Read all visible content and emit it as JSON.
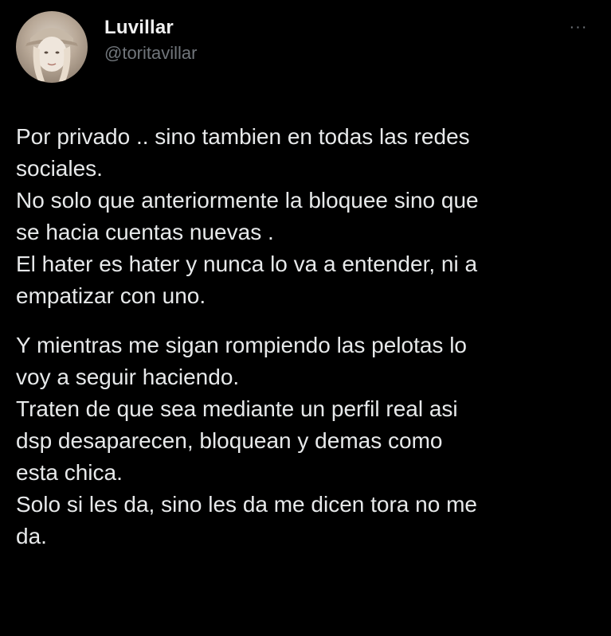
{
  "tweet": {
    "display_name": "Luvillar",
    "handle": "@toritavillar",
    "more_label": "···",
    "paragraphs": [
      {
        "lines": [
          "Por privado .. sino tambien en todas las redes",
          "sociales.",
          "No solo que anteriormente la bloquee sino que",
          "se hacia cuentas nuevas .",
          "El hater es hater y nunca lo va a entender, ni a",
          "empatizar con uno."
        ]
      },
      {
        "lines": [
          "Y mientras me sigan rompiendo las pelotas lo",
          "voy a seguir haciendo.",
          "Traten de que sea mediante un perfil real asi",
          "dsp desaparecen, bloquean y demas como",
          "esta chica.",
          "Solo si les da, sino les da me dicen tora no me",
          "da."
        ]
      }
    ]
  },
  "colors": {
    "background": "#000000",
    "text": "#e7e9ea",
    "secondary": "#71767b"
  },
  "icons": {
    "more": "more-horizontal-icon",
    "avatar": "profile-avatar"
  }
}
